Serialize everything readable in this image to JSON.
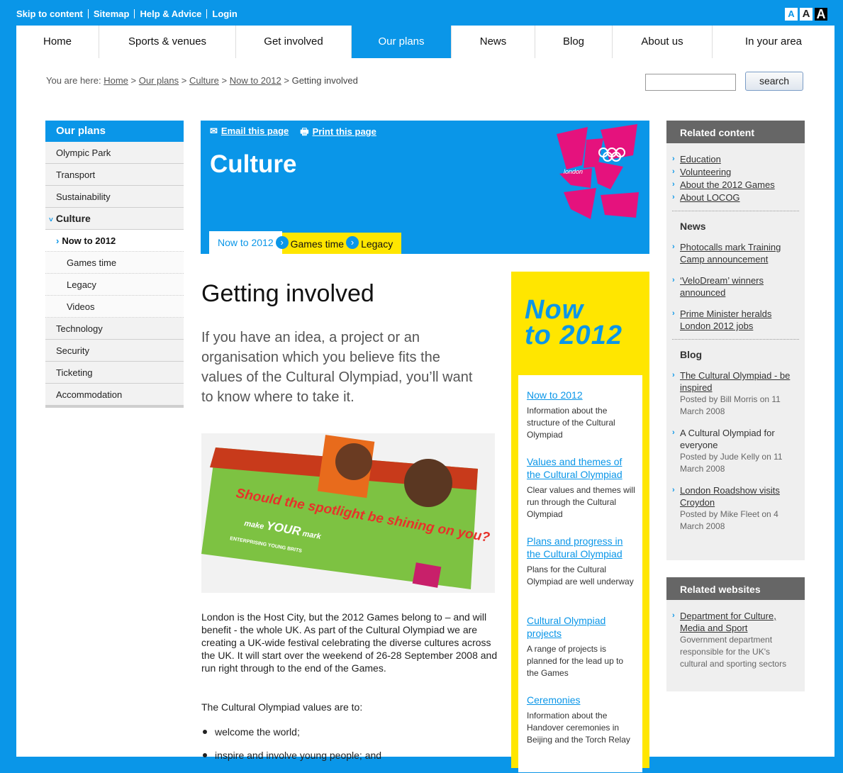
{
  "utility": {
    "skip": "Skip to content",
    "sitemap": "Sitemap",
    "help": "Help & Advice",
    "login": "Login",
    "size_a1": "A",
    "size_a2": "A",
    "size_a3": "A"
  },
  "nav": {
    "items": [
      "Home",
      "Sports & venues",
      "Get involved",
      "Our plans",
      "News",
      "Blog",
      "About us",
      "In your area"
    ],
    "active": "Our plans"
  },
  "breadcrumb": {
    "prefix": "You are here:",
    "home": "Home",
    "our_plans": "Our plans",
    "culture": "Culture",
    "now": "Now to 2012",
    "current": "Getting involved",
    "sep": ">"
  },
  "search": {
    "value": "",
    "button": "search"
  },
  "leftnav": {
    "heading": "Our plans",
    "items": [
      "Olympic Park",
      "Transport",
      "Sustainability"
    ],
    "culture": "Culture",
    "sub": [
      "Now to 2012",
      "Games time",
      "Legacy",
      "Videos"
    ],
    "items2": [
      "Technology",
      "Security",
      "Ticketing",
      "Accommodation"
    ]
  },
  "banner": {
    "email": "Email this page",
    "print": "Print this page",
    "title": "Culture",
    "logo_text": "london"
  },
  "tabs": [
    "Now to 2012",
    "Games time",
    "Legacy"
  ],
  "main": {
    "heading": "Getting involved",
    "intro": "If you have an idea, a project or an organisation which you believe fits the values of the Cultural Olympiad, you’ll want to know where to take it.",
    "photo_text": "Should the spotlight be shining on you?",
    "photo_sub1": "make",
    "photo_sub2": "YOUR",
    "photo_sub3": "mark",
    "photo_sub4": "ENTERPRISING YOUNG BRITS",
    "body": "London is the Host City, but the 2012 Games belong to – and will benefit - the whole UK. As part of the Cultural Olympiad we are creating a UK-wide festival celebrating the diverse cultures across the UK. It will start over the weekend of 26-28 September 2008 and run right through to the end of the Games.",
    "values_intro": "The Cultural Olympiad values are to:",
    "bullets": [
      "welcome the world;",
      "inspire and involve young people; and"
    ]
  },
  "promo": {
    "title1": "Now",
    "title2": "to 2012",
    "items": [
      {
        "link": "Now to 2012",
        "desc": "Information about the structure of the Cultural Olympiad"
      },
      {
        "link": "Values and themes of the Cultural Olympiad",
        "desc": "Clear values and themes will run through the Cultural Olympiad"
      },
      {
        "link": "Plans and progress in the Cultural Olympiad",
        "desc": "Plans for the Cultural Olympiad are well underway"
      },
      {
        "link": "Cultural Olympiad projects",
        "desc": "A range of projects is planned for the lead up to the Games"
      },
      {
        "link": "Ceremonies",
        "desc": "Information about the Handover ceremonies in Beijing and the Torch Relay"
      }
    ]
  },
  "related": {
    "heading": "Related content",
    "links": [
      "Education",
      "Volunteering",
      "About the 2012 Games",
      "About LOCOG"
    ],
    "news_heading": "News",
    "news": [
      "Photocalls mark Training Camp announcement",
      "‘VeloDream’ winners announced",
      "Prime Minister heralds London 2012 jobs"
    ],
    "blog_heading": "Blog",
    "blog": [
      {
        "title": "The Cultural Olympiad - be inspired",
        "meta": "Posted by Bill Morris on 11 March 2008"
      },
      {
        "title": "A Cultural Olympiad for everyone",
        "meta": "Posted by Jude Kelly on 11 March 2008"
      },
      {
        "title": "London Roadshow visits Croydon",
        "meta": "Posted by Mike Fleet on 4 March 2008"
      }
    ]
  },
  "websites": {
    "heading": "Related websites",
    "link": "Department for Culture, Media and Sport",
    "desc": "Government department responsible for the UK's cultural and sporting sectors"
  },
  "colors": {
    "brand_blue": "#0a96e8",
    "yellow": "#ffe600",
    "logo_pink": "#e5127d",
    "grey_header": "#666666"
  }
}
